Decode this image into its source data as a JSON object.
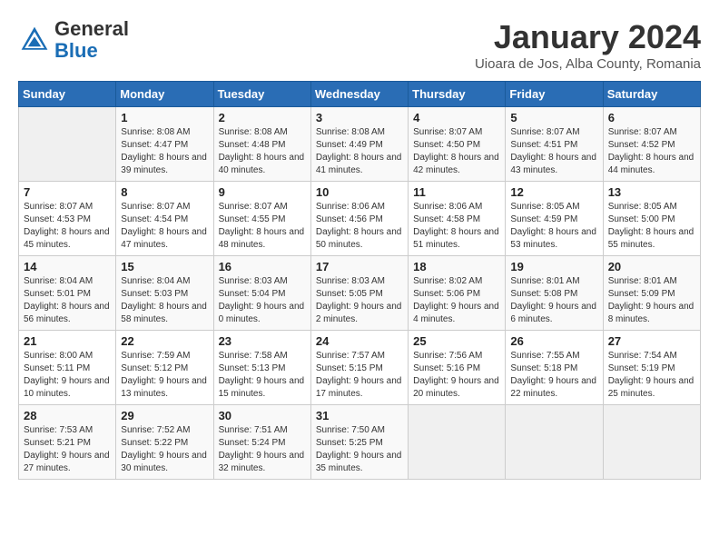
{
  "header": {
    "logo_general": "General",
    "logo_blue": "Blue",
    "month_title": "January 2024",
    "location": "Uioara de Jos, Alba County, Romania"
  },
  "weekdays": [
    "Sunday",
    "Monday",
    "Tuesday",
    "Wednesday",
    "Thursday",
    "Friday",
    "Saturday"
  ],
  "weeks": [
    [
      {
        "day": "",
        "sunrise": "",
        "sunset": "",
        "daylight": ""
      },
      {
        "day": "1",
        "sunrise": "Sunrise: 8:08 AM",
        "sunset": "Sunset: 4:47 PM",
        "daylight": "Daylight: 8 hours and 39 minutes."
      },
      {
        "day": "2",
        "sunrise": "Sunrise: 8:08 AM",
        "sunset": "Sunset: 4:48 PM",
        "daylight": "Daylight: 8 hours and 40 minutes."
      },
      {
        "day": "3",
        "sunrise": "Sunrise: 8:08 AM",
        "sunset": "Sunset: 4:49 PM",
        "daylight": "Daylight: 8 hours and 41 minutes."
      },
      {
        "day": "4",
        "sunrise": "Sunrise: 8:07 AM",
        "sunset": "Sunset: 4:50 PM",
        "daylight": "Daylight: 8 hours and 42 minutes."
      },
      {
        "day": "5",
        "sunrise": "Sunrise: 8:07 AM",
        "sunset": "Sunset: 4:51 PM",
        "daylight": "Daylight: 8 hours and 43 minutes."
      },
      {
        "day": "6",
        "sunrise": "Sunrise: 8:07 AM",
        "sunset": "Sunset: 4:52 PM",
        "daylight": "Daylight: 8 hours and 44 minutes."
      }
    ],
    [
      {
        "day": "7",
        "sunrise": "Sunrise: 8:07 AM",
        "sunset": "Sunset: 4:53 PM",
        "daylight": "Daylight: 8 hours and 45 minutes."
      },
      {
        "day": "8",
        "sunrise": "Sunrise: 8:07 AM",
        "sunset": "Sunset: 4:54 PM",
        "daylight": "Daylight: 8 hours and 47 minutes."
      },
      {
        "day": "9",
        "sunrise": "Sunrise: 8:07 AM",
        "sunset": "Sunset: 4:55 PM",
        "daylight": "Daylight: 8 hours and 48 minutes."
      },
      {
        "day": "10",
        "sunrise": "Sunrise: 8:06 AM",
        "sunset": "Sunset: 4:56 PM",
        "daylight": "Daylight: 8 hours and 50 minutes."
      },
      {
        "day": "11",
        "sunrise": "Sunrise: 8:06 AM",
        "sunset": "Sunset: 4:58 PM",
        "daylight": "Daylight: 8 hours and 51 minutes."
      },
      {
        "day": "12",
        "sunrise": "Sunrise: 8:05 AM",
        "sunset": "Sunset: 4:59 PM",
        "daylight": "Daylight: 8 hours and 53 minutes."
      },
      {
        "day": "13",
        "sunrise": "Sunrise: 8:05 AM",
        "sunset": "Sunset: 5:00 PM",
        "daylight": "Daylight: 8 hours and 55 minutes."
      }
    ],
    [
      {
        "day": "14",
        "sunrise": "Sunrise: 8:04 AM",
        "sunset": "Sunset: 5:01 PM",
        "daylight": "Daylight: 8 hours and 56 minutes."
      },
      {
        "day": "15",
        "sunrise": "Sunrise: 8:04 AM",
        "sunset": "Sunset: 5:03 PM",
        "daylight": "Daylight: 8 hours and 58 minutes."
      },
      {
        "day": "16",
        "sunrise": "Sunrise: 8:03 AM",
        "sunset": "Sunset: 5:04 PM",
        "daylight": "Daylight: 9 hours and 0 minutes."
      },
      {
        "day": "17",
        "sunrise": "Sunrise: 8:03 AM",
        "sunset": "Sunset: 5:05 PM",
        "daylight": "Daylight: 9 hours and 2 minutes."
      },
      {
        "day": "18",
        "sunrise": "Sunrise: 8:02 AM",
        "sunset": "Sunset: 5:06 PM",
        "daylight": "Daylight: 9 hours and 4 minutes."
      },
      {
        "day": "19",
        "sunrise": "Sunrise: 8:01 AM",
        "sunset": "Sunset: 5:08 PM",
        "daylight": "Daylight: 9 hours and 6 minutes."
      },
      {
        "day": "20",
        "sunrise": "Sunrise: 8:01 AM",
        "sunset": "Sunset: 5:09 PM",
        "daylight": "Daylight: 9 hours and 8 minutes."
      }
    ],
    [
      {
        "day": "21",
        "sunrise": "Sunrise: 8:00 AM",
        "sunset": "Sunset: 5:11 PM",
        "daylight": "Daylight: 9 hours and 10 minutes."
      },
      {
        "day": "22",
        "sunrise": "Sunrise: 7:59 AM",
        "sunset": "Sunset: 5:12 PM",
        "daylight": "Daylight: 9 hours and 13 minutes."
      },
      {
        "day": "23",
        "sunrise": "Sunrise: 7:58 AM",
        "sunset": "Sunset: 5:13 PM",
        "daylight": "Daylight: 9 hours and 15 minutes."
      },
      {
        "day": "24",
        "sunrise": "Sunrise: 7:57 AM",
        "sunset": "Sunset: 5:15 PM",
        "daylight": "Daylight: 9 hours and 17 minutes."
      },
      {
        "day": "25",
        "sunrise": "Sunrise: 7:56 AM",
        "sunset": "Sunset: 5:16 PM",
        "daylight": "Daylight: 9 hours and 20 minutes."
      },
      {
        "day": "26",
        "sunrise": "Sunrise: 7:55 AM",
        "sunset": "Sunset: 5:18 PM",
        "daylight": "Daylight: 9 hours and 22 minutes."
      },
      {
        "day": "27",
        "sunrise": "Sunrise: 7:54 AM",
        "sunset": "Sunset: 5:19 PM",
        "daylight": "Daylight: 9 hours and 25 minutes."
      }
    ],
    [
      {
        "day": "28",
        "sunrise": "Sunrise: 7:53 AM",
        "sunset": "Sunset: 5:21 PM",
        "daylight": "Daylight: 9 hours and 27 minutes."
      },
      {
        "day": "29",
        "sunrise": "Sunrise: 7:52 AM",
        "sunset": "Sunset: 5:22 PM",
        "daylight": "Daylight: 9 hours and 30 minutes."
      },
      {
        "day": "30",
        "sunrise": "Sunrise: 7:51 AM",
        "sunset": "Sunset: 5:24 PM",
        "daylight": "Daylight: 9 hours and 32 minutes."
      },
      {
        "day": "31",
        "sunrise": "Sunrise: 7:50 AM",
        "sunset": "Sunset: 5:25 PM",
        "daylight": "Daylight: 9 hours and 35 minutes."
      },
      {
        "day": "",
        "sunrise": "",
        "sunset": "",
        "daylight": ""
      },
      {
        "day": "",
        "sunrise": "",
        "sunset": "",
        "daylight": ""
      },
      {
        "day": "",
        "sunrise": "",
        "sunset": "",
        "daylight": ""
      }
    ]
  ]
}
